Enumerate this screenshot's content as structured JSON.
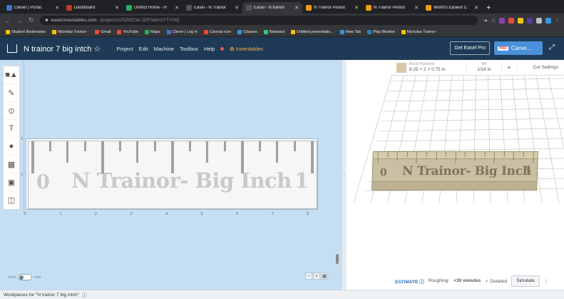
{
  "browser": {
    "tabs": [
      {
        "title": "Clever | Portal",
        "color": "#4472c4",
        "active": false
      },
      {
        "title": "Dashboard",
        "color": "#c0392b",
        "active": false
      },
      {
        "title": "District Home - H",
        "color": "#27ae60",
        "active": false
      },
      {
        "title": "Easel - N Trainor",
        "color": "#555555",
        "active": false
      },
      {
        "title": "Easel - N trainor",
        "color": "#555555",
        "active": true
      },
      {
        "title": "N Trainor Period",
        "color": "#f39c12",
        "active": false
      },
      {
        "title": "N Trainor Period",
        "color": "#f39c12",
        "active": false
      },
      {
        "title": "World's Easiest C",
        "color": "#f39c12",
        "active": false
      }
    ],
    "new_tab": "+",
    "url_host": "easel.inventables.com",
    "url_path": "/projects/USZtSCW-1DF0a0n2YTV0tQ",
    "bookmarks": [
      {
        "label": "Student Bookmarks",
        "color": "#f1c40f"
      },
      {
        "label": "Nicholas Trainor -",
        "color": "#f1c40f"
      },
      {
        "label": "Gmail",
        "color": "#e74c3c"
      },
      {
        "label": "YouTube",
        "color": "#e74c3c"
      },
      {
        "label": "Maps",
        "color": "#27ae60"
      },
      {
        "label": "Clever | Log in",
        "color": "#4472c4"
      },
      {
        "label": "Canvas icon",
        "color": "#e74c3c"
      },
      {
        "label": "Classes",
        "color": "#3498db"
      },
      {
        "label": "Nearpod",
        "color": "#2ecc71"
      },
      {
        "label": "Untitled presentatio...",
        "color": "#f1c40f"
      },
      {
        "label": "New Tab",
        "color": "#3498db"
      },
      {
        "label": "Play Blooket",
        "color": "#2980b9"
      },
      {
        "label": "Nicholas Trainor -",
        "color": "#f1c40f"
      }
    ]
  },
  "header": {
    "title": "N trainor 7 big intch ☆",
    "menu": [
      "Project",
      "Edit",
      "Machine",
      "Toolbox",
      "Help"
    ],
    "inventables": "Inventables",
    "get_pro": "Get Easel Pro",
    "pro_badge": "PRO",
    "carve": "Carve..."
  },
  "design": {
    "label": "N Trainor- Big Inch",
    "left_num": "0",
    "right_num": "1",
    "x_ticks": [
      "0",
      "1",
      "2",
      "3",
      "4",
      "5",
      "6",
      "7",
      "8"
    ],
    "y_top": "2",
    "y_mid": "1",
    "units_left": "inch",
    "units_right": "mm"
  },
  "material": {
    "name": "Birch Plywood",
    "size": "8.25 × 2 × 0.75 in",
    "bit_label": "Bit",
    "bit_value": "1/16 in",
    "add": "+",
    "cut_settings": "Cut Settings"
  },
  "estimate": {
    "label": "ESTIMATE",
    "roughing_label": "Roughing:",
    "roughing_value": "<30 minutes",
    "detailed": "Detailed",
    "simulate": "Simulate"
  },
  "footer": {
    "workpieces": "Workpieces for \"N trainor 7 big intch\""
  }
}
